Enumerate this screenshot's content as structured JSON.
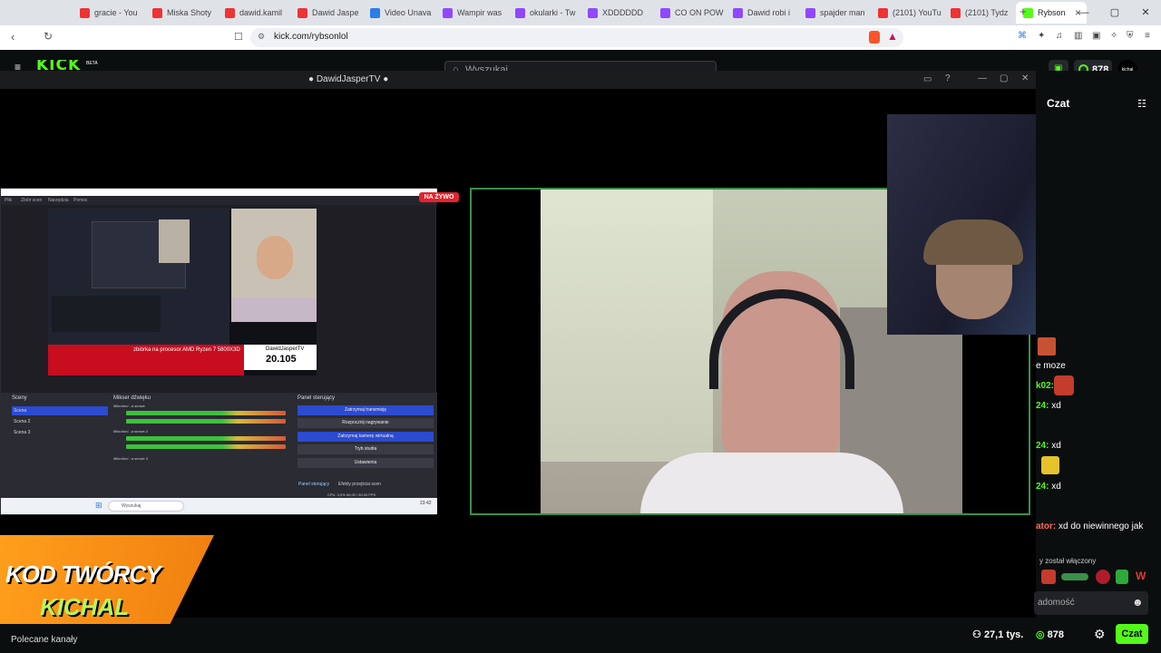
{
  "browser": {
    "tabs": [
      {
        "label": "gracie - You",
        "fav": "#e33"
      },
      {
        "label": "Miska Shoty",
        "fav": "#e33"
      },
      {
        "label": "dawid.kamil",
        "fav": "#e33"
      },
      {
        "label": "Dawid Jaspe",
        "fav": "#e33"
      },
      {
        "label": "Video Unava",
        "fav": "#2b7de9"
      },
      {
        "label": "Wampir was",
        "fav": "#9147ff"
      },
      {
        "label": "okularki - Tw",
        "fav": "#9147ff"
      },
      {
        "label": "XDDDDDD",
        "fav": "#9147ff"
      },
      {
        "label": "CO ON POW",
        "fav": "#9147ff"
      },
      {
        "label": "Dawid robi i",
        "fav": "#9147ff"
      },
      {
        "label": "spajder man",
        "fav": "#9147ff"
      },
      {
        "label": "(2101) YouTu",
        "fav": "#e33"
      },
      {
        "label": "(2101) Tydz",
        "fav": "#e33"
      },
      {
        "label": "Rybson",
        "fav": "#53fc18"
      }
    ],
    "url": "kick.com/rybsonlol",
    "new_tab": "+"
  },
  "kick": {
    "logo": "KICK",
    "beta": "BETA",
    "search_placeholder": "Wyszukaj",
    "coins": "878",
    "avatar_text": "kichal"
  },
  "viewer": {
    "title": "DawidJasperTV"
  },
  "obs": {
    "menu": [
      "Plik",
      "Zbiór scen",
      "Narzędzia",
      "Pomoc"
    ],
    "live_badge": "NA ŻYWO",
    "preview_banner": "zbiórka na procesor AMD Ryzen 7 5800X3D",
    "preview_channel": "DawidJasperTV",
    "preview_count": "20.105",
    "panels": {
      "scenes": "Sceny",
      "mixer": "Mikser dźwięku",
      "controls": "Panel sterujący"
    },
    "scenes": [
      "Scena",
      "Scena 2",
      "Scena 3"
    ],
    "mixer_labels": [
      "Mikrofon/...a snowe",
      "Mikrofon/...a snowe 2",
      "Mikrofon/...a snowe 3"
    ],
    "controls": [
      {
        "label": "Zatrzymaj transmisję",
        "blue": true
      },
      {
        "label": "Rozpocznij nagrywanie",
        "blue": false
      },
      {
        "label": "Zatrzymaj kamerę wirtualną",
        "blue": true
      },
      {
        "label": "Tryb studia",
        "blue": false
      },
      {
        "label": "Ustawienia",
        "blue": false
      }
    ],
    "tabs": [
      "Panel sterujący",
      "Efekty przejścia scen"
    ],
    "status": "CPU: 3,0%   60,00 / 60,00 FPS",
    "taskbar_search": "Wyszukaj",
    "clock": "23:42"
  },
  "chat": {
    "header": "Czat",
    "lines": [
      {
        "name": "",
        "text": "e moze"
      },
      {
        "name": "k02:",
        "text": ""
      },
      {
        "name": "24:",
        "text": "xd"
      },
      {
        "name": "24:",
        "text": "xd"
      },
      {
        "name": "24:",
        "text": "xd"
      },
      {
        "name": "ator:",
        "text": "xd do niewinnego jak"
      }
    ],
    "system": "y został włączony",
    "input_placeholder": "adomość"
  },
  "creator": {
    "line1": "KOD TWÓRCY",
    "line2": "KICHAL"
  },
  "footer": {
    "recommended": "Polecane kanały",
    "viewers": "27,1 tys.",
    "coins": "878",
    "chat_button": "Czat"
  }
}
